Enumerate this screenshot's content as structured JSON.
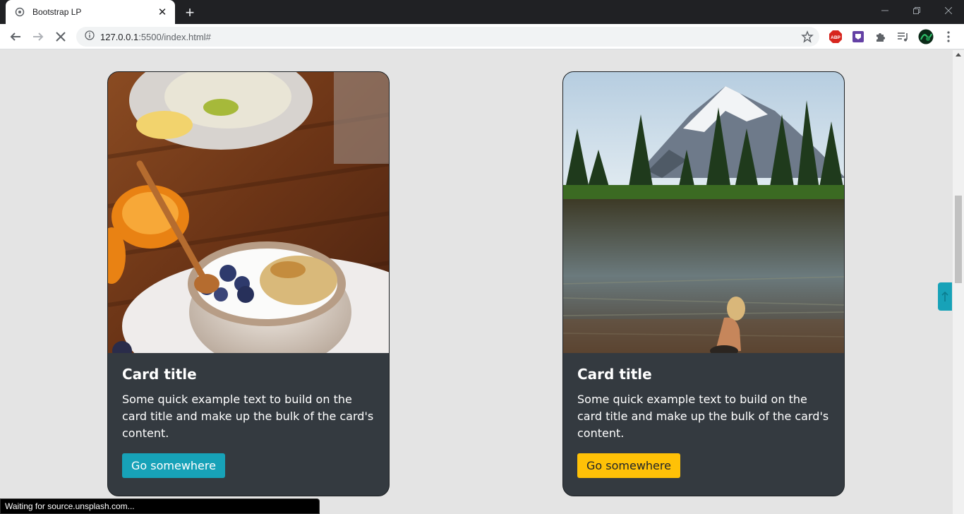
{
  "browser": {
    "tab_title": "Bootstrap LP",
    "url_host": "127.0.0.1",
    "url_rest": ":5500/index.html#",
    "status_text": "Waiting for source.unsplash.com..."
  },
  "cards": [
    {
      "title": "Card title",
      "text": "Some quick example text to build on the card title and make up the bulk of the card's content.",
      "button_label": "Go somewhere",
      "button_color": "#17a2b8",
      "image": "breakfast bowl with blueberries and granola"
    },
    {
      "title": "Card title",
      "text": "Some quick example text to build on the card title and make up the bulk of the card's content.",
      "button_label": "Go somewhere",
      "button_color": "#ffc107",
      "image": "mountain lake with child wading"
    }
  ],
  "colors": {
    "page_bg": "#e4e4e4",
    "card_bg": "#343a40",
    "info": "#17a2b8",
    "warning": "#ffc107"
  }
}
